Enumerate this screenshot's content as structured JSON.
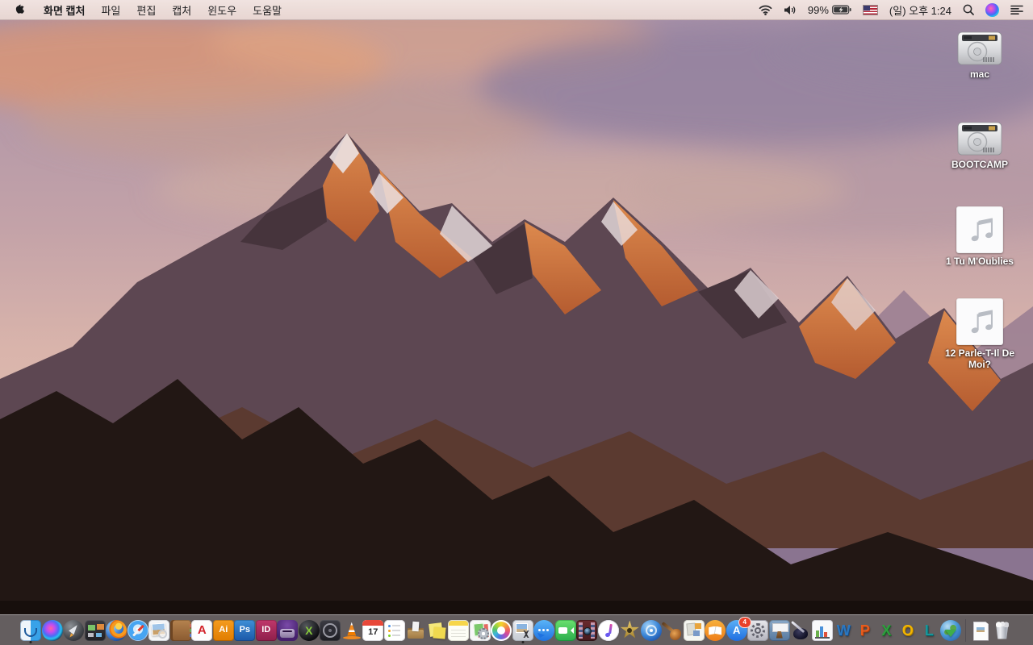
{
  "menubar": {
    "apple_menu": "apple-logo",
    "app_name": "화면 캡처",
    "menus": [
      "파일",
      "편집",
      "캡처",
      "윈도우",
      "도움말"
    ],
    "status": {
      "wifi": "wifi-icon",
      "volume": "volume-icon",
      "battery_percent": "99%",
      "battery_state": "charging",
      "input_source": "us-flag",
      "clock": "(일) 오후 1:24",
      "spotlight": "search-icon",
      "siri": "siri-icon",
      "notification_center": "list-icon"
    }
  },
  "desktop": {
    "wallpaper": "macos-sierra-mountain",
    "icons": [
      {
        "type": "drive",
        "label": "mac"
      },
      {
        "type": "drive",
        "label": "BOOTCAMP"
      },
      {
        "type": "music",
        "label": "1 Tu M'Oublies"
      },
      {
        "type": "music",
        "label": "12 Parle-T-Il De Moi?"
      }
    ]
  },
  "dock": {
    "apps": [
      {
        "name": "finder",
        "running": true
      },
      {
        "name": "siri"
      },
      {
        "name": "launchpad"
      },
      {
        "name": "mission-control"
      },
      {
        "name": "firefox"
      },
      {
        "name": "safari"
      },
      {
        "name": "preview"
      },
      {
        "name": "contacts"
      },
      {
        "name": "acrobat",
        "glyph": "A"
      },
      {
        "name": "illustrator",
        "glyph": "Ai"
      },
      {
        "name": "photoshop",
        "glyph": "Ps"
      },
      {
        "name": "indesign",
        "glyph": "ID"
      },
      {
        "name": "toast"
      },
      {
        "name": "video-converter",
        "glyph": "X"
      },
      {
        "name": "disc-reel"
      },
      {
        "name": "vlc"
      },
      {
        "name": "calendar",
        "glyph": "17"
      },
      {
        "name": "reminders"
      },
      {
        "name": "archive-box"
      },
      {
        "name": "stickies"
      },
      {
        "name": "notes"
      },
      {
        "name": "doc-manager"
      },
      {
        "name": "photos"
      },
      {
        "name": "grab",
        "running": true
      },
      {
        "name": "messages"
      },
      {
        "name": "facetime"
      },
      {
        "name": "photo-booth"
      },
      {
        "name": "itunes"
      },
      {
        "name": "imovie"
      },
      {
        "name": "dvd-ripper"
      },
      {
        "name": "garageband"
      },
      {
        "name": "scrapbook"
      },
      {
        "name": "ibooks"
      },
      {
        "name": "app-store",
        "glyph": "A",
        "badge": "4"
      },
      {
        "name": "system-preferences"
      },
      {
        "name": "keynote"
      },
      {
        "name": "pages"
      },
      {
        "name": "numbers"
      },
      {
        "name": "word",
        "glyph": "W"
      },
      {
        "name": "powerpoint",
        "glyph": "P"
      },
      {
        "name": "excel",
        "glyph": "X"
      },
      {
        "name": "outlook",
        "glyph": "O"
      },
      {
        "name": "lync",
        "glyph": "L"
      },
      {
        "name": "globe-download"
      }
    ],
    "files": [
      {
        "name": "document-file"
      },
      {
        "name": "trash-full"
      }
    ]
  },
  "colors": {
    "menubar_bg": "#eedcd8",
    "dock_bg": "rgba(208,204,212,0.42)",
    "badge_red": "#e8402a",
    "sky_top": "#a992ab",
    "alpenglow": "#cf7440",
    "foreground_rock": "#221714"
  }
}
